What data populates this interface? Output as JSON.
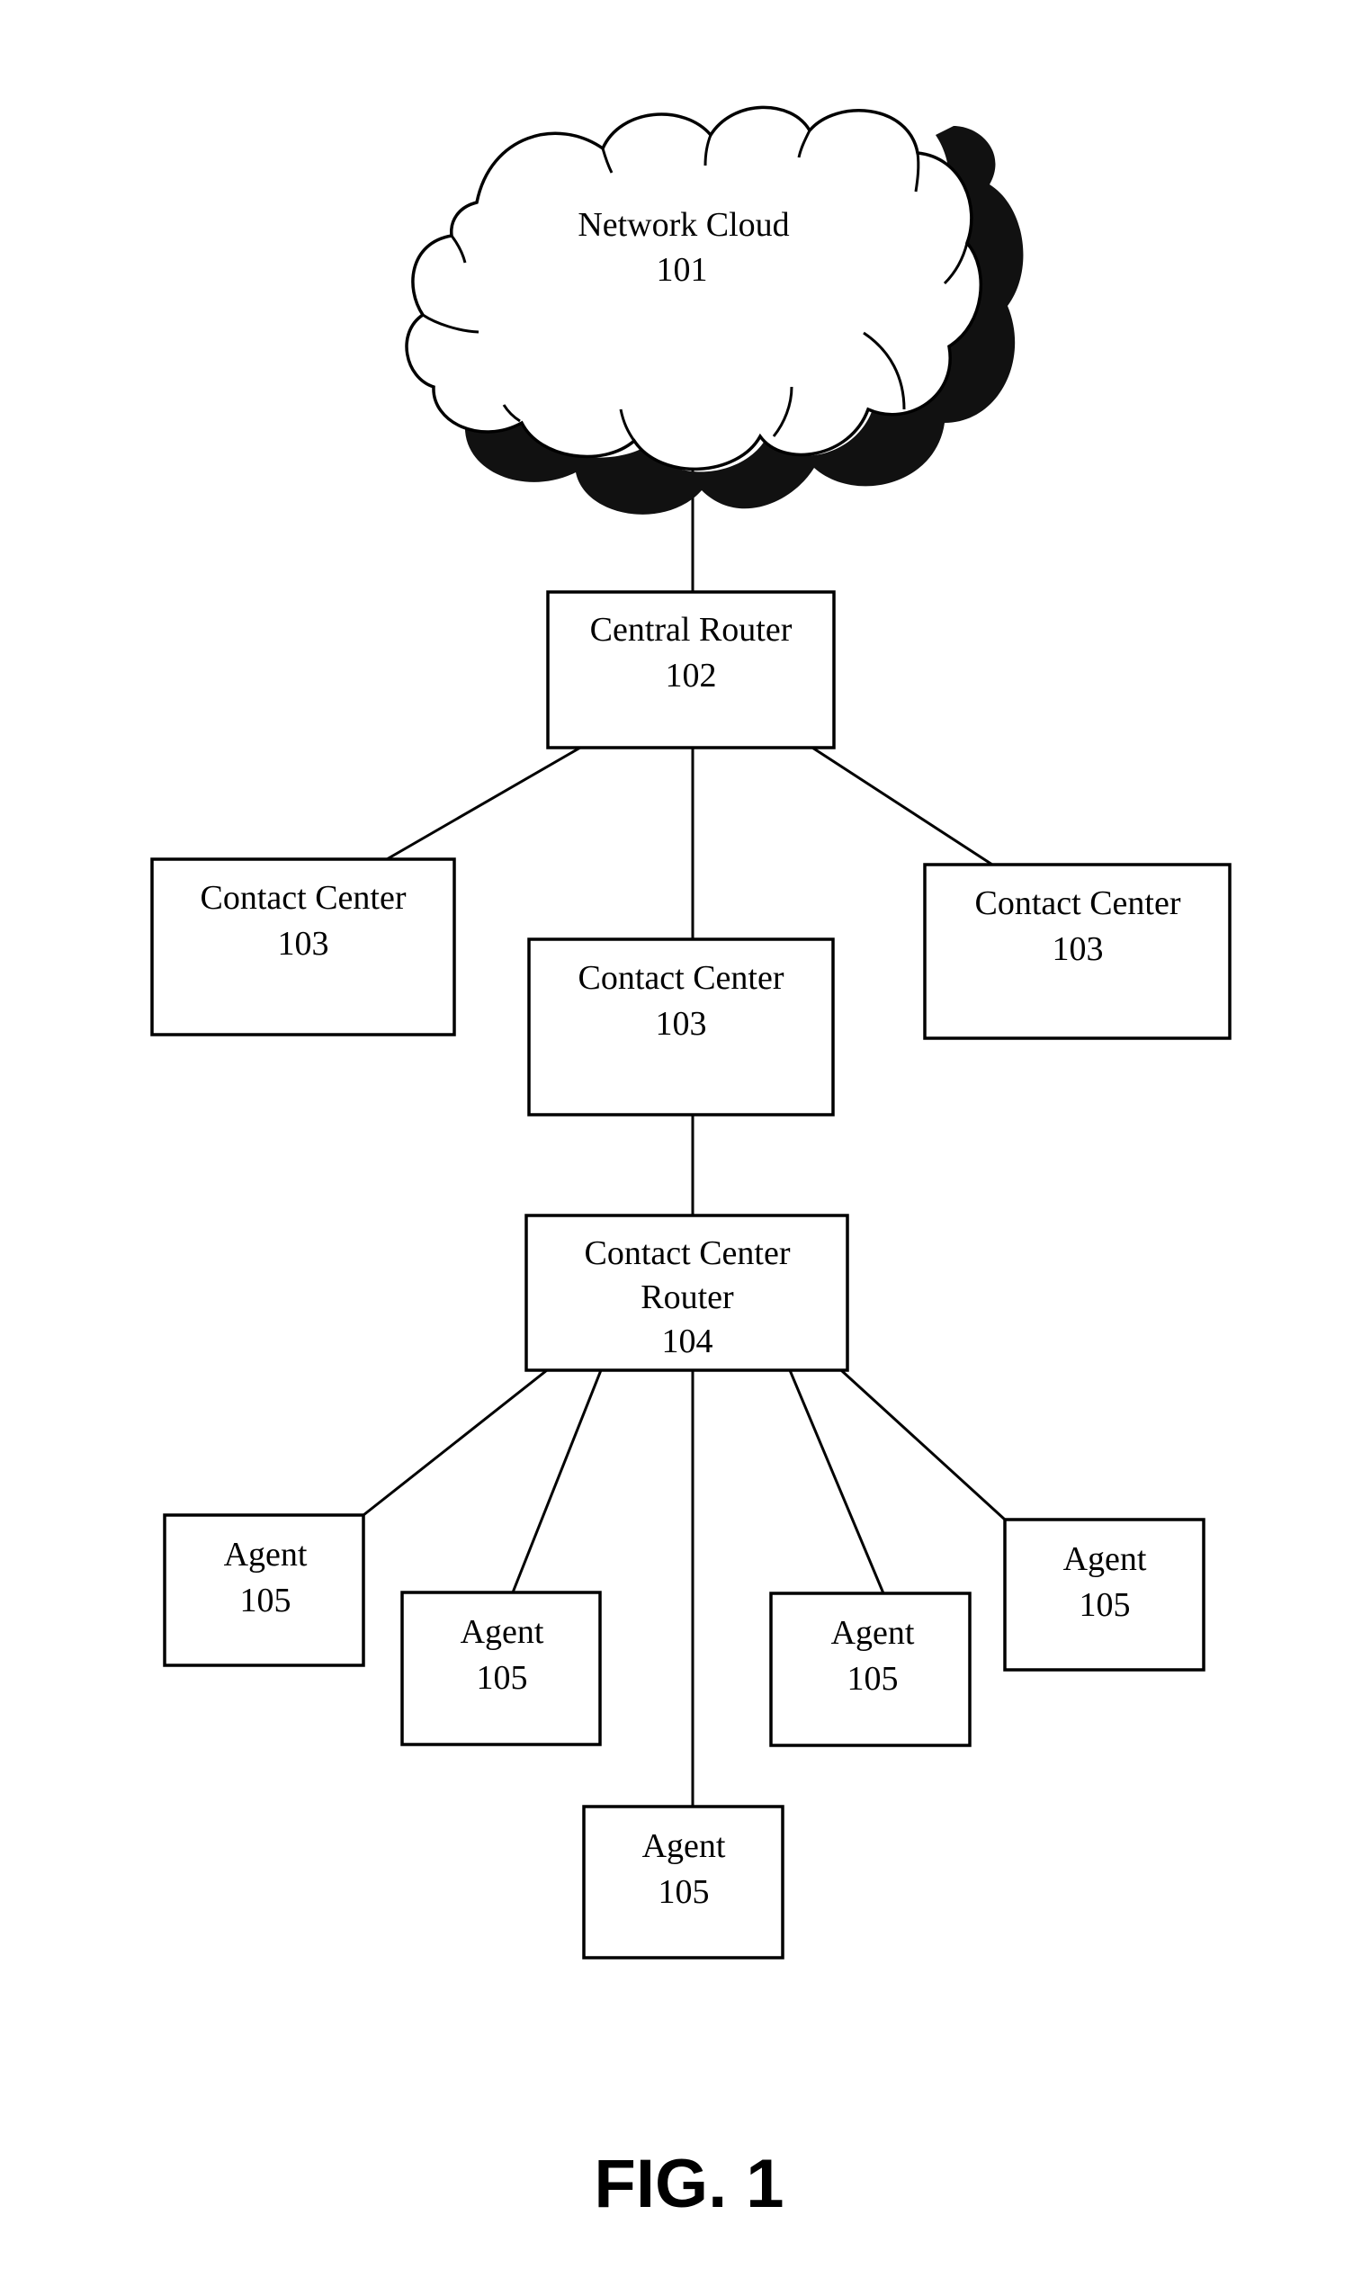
{
  "figure": {
    "label": "FIG. 1"
  },
  "nodes": {
    "cloud": {
      "lines": [
        "Network Cloud",
        "101"
      ]
    },
    "central_router": {
      "lines": [
        "Central Router",
        "102"
      ]
    },
    "contact_center_left": {
      "lines": [
        "Contact Center",
        "103"
      ]
    },
    "contact_center_middle": {
      "lines": [
        "Contact Center",
        "103"
      ]
    },
    "contact_center_right": {
      "lines": [
        "Contact Center",
        "103"
      ]
    },
    "contact_center_router": {
      "lines": [
        "Contact Center",
        "Router",
        "104"
      ]
    },
    "agent_1": {
      "lines": [
        "Agent",
        "105"
      ]
    },
    "agent_2": {
      "lines": [
        "Agent",
        "105"
      ]
    },
    "agent_3": {
      "lines": [
        "Agent",
        "105"
      ]
    },
    "agent_4": {
      "lines": [
        "Agent",
        "105"
      ]
    },
    "agent_5": {
      "lines": [
        "Agent",
        "105"
      ]
    }
  },
  "edges": [
    [
      "cloud",
      "central_router"
    ],
    [
      "central_router",
      "contact_center_left"
    ],
    [
      "central_router",
      "contact_center_middle"
    ],
    [
      "central_router",
      "contact_center_right"
    ],
    [
      "contact_center_middle",
      "contact_center_router"
    ],
    [
      "contact_center_router",
      "agent_1"
    ],
    [
      "contact_center_router",
      "agent_2"
    ],
    [
      "contact_center_router",
      "agent_3"
    ],
    [
      "contact_center_router",
      "agent_4"
    ],
    [
      "contact_center_router",
      "agent_5"
    ]
  ]
}
